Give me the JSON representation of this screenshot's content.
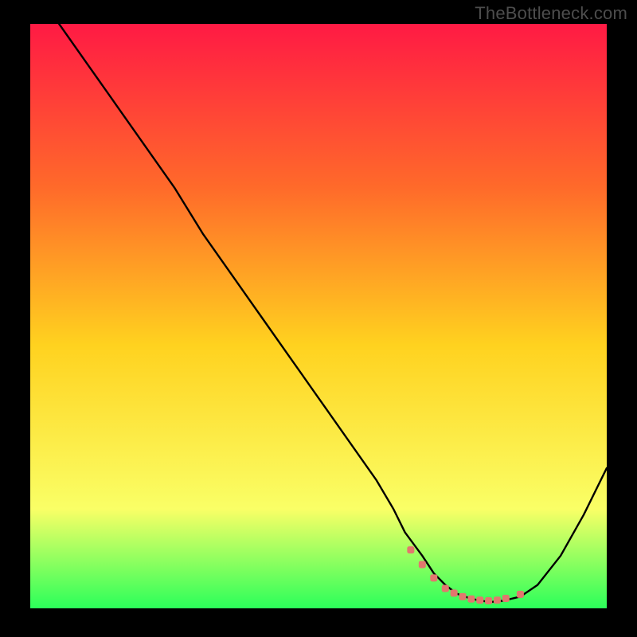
{
  "watermark": "TheBottleneck.com",
  "colors": {
    "bg": "#000000",
    "gradient_top": "#ff1a44",
    "gradient_mid_upper": "#ff6a2a",
    "gradient_mid": "#ffd21f",
    "gradient_lower": "#faff66",
    "gradient_bottom": "#2bff5a",
    "curve": "#000000",
    "markers": "#e2776e"
  },
  "chart_data": {
    "type": "line",
    "title": "",
    "xlabel": "",
    "ylabel": "",
    "xlim": [
      0,
      100
    ],
    "ylim": [
      0,
      100
    ],
    "grid": false,
    "legend": false,
    "series": [
      {
        "name": "bottleneck-curve",
        "x": [
          5,
          10,
          15,
          20,
          25,
          30,
          35,
          40,
          45,
          50,
          55,
          60,
          63,
          65,
          68,
          70,
          72,
          74,
          76,
          78,
          80,
          82,
          85,
          88,
          92,
          96,
          100
        ],
        "y": [
          100,
          93,
          86,
          79,
          72,
          64,
          57,
          50,
          43,
          36,
          29,
          22,
          17,
          13,
          9,
          6,
          4,
          2.5,
          1.8,
          1.3,
          1.1,
          1.3,
          2,
          4,
          9,
          16,
          24
        ]
      }
    ],
    "markers": {
      "name": "optimal-range",
      "x": [
        66,
        68,
        70,
        72,
        73.5,
        75,
        76.5,
        78,
        79.5,
        81,
        82.5,
        85
      ],
      "y": [
        10,
        7.5,
        5.2,
        3.4,
        2.6,
        2.0,
        1.6,
        1.4,
        1.3,
        1.4,
        1.7,
        2.4
      ]
    }
  }
}
